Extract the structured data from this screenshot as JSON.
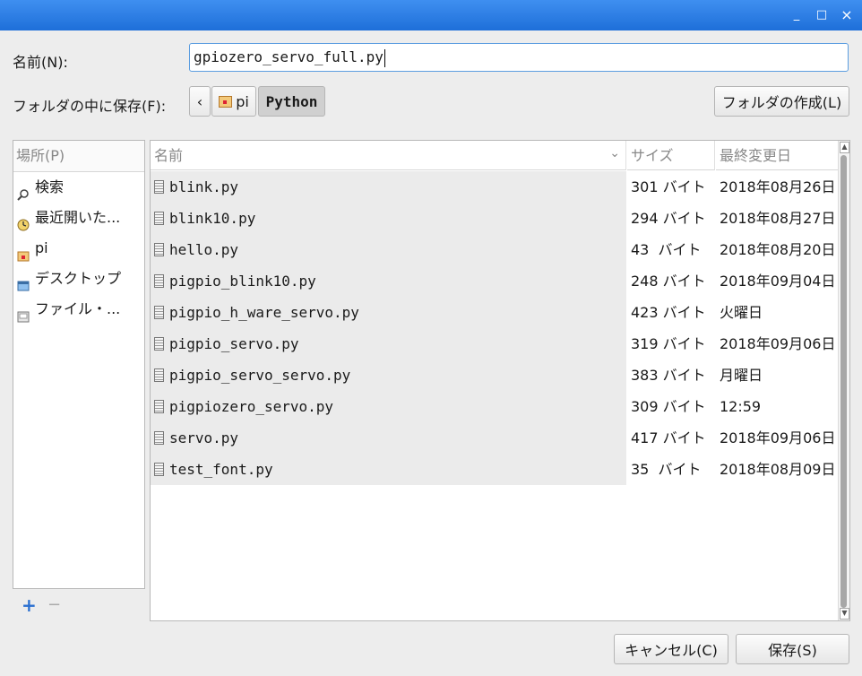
{
  "window": {
    "minimize_glyph": "_",
    "maximize_glyph": "□",
    "close_glyph": "×"
  },
  "name_row": {
    "label": "名前(N):",
    "value": "gpiozero_servo_full.py"
  },
  "folder_row": {
    "label": "フォルダの中に保存(F):",
    "back_glyph": "‹",
    "path": [
      "pi",
      "Python"
    ],
    "create_folder_label": "フォルダの作成(L)"
  },
  "places": {
    "header": "場所(P)",
    "items": [
      {
        "label": "検索",
        "icon": "search-icon"
      },
      {
        "label": "最近開いた...",
        "icon": "clock-icon"
      },
      {
        "label": "pi",
        "icon": "home-folder-icon"
      },
      {
        "label": "デスクトップ",
        "icon": "desktop-icon"
      },
      {
        "label": "ファイル・...",
        "icon": "drive-icon"
      }
    ],
    "add_glyph": "+",
    "remove_glyph": "−"
  },
  "files": {
    "columns": {
      "name": "名前",
      "size": "サイズ",
      "modified": "最終変更日"
    },
    "sort_glyph": "⌄",
    "rows": [
      {
        "name": "blink.py",
        "size": "301 バイト",
        "modified": "2018年08月26日"
      },
      {
        "name": "blink10.py",
        "size": "294 バイト",
        "modified": "2018年08月27日"
      },
      {
        "name": "hello.py",
        "size": "43  バイト",
        "modified": "2018年08月20日"
      },
      {
        "name": "pigpio_blink10.py",
        "size": "248 バイト",
        "modified": "2018年09月04日"
      },
      {
        "name": "pigpio_h_ware_servo.py",
        "size": "423 バイト",
        "modified": "火曜日"
      },
      {
        "name": "pigpio_servo.py",
        "size": "319 バイト",
        "modified": "2018年09月06日"
      },
      {
        "name": "pigpio_servo_servo.py",
        "size": "383 バイト",
        "modified": "月曜日"
      },
      {
        "name": "pigpiozero_servo.py",
        "size": "309 バイト",
        "modified": "12:59"
      },
      {
        "name": "servo.py",
        "size": "417 バイト",
        "modified": "2018年09月06日"
      },
      {
        "name": "test_font.py",
        "size": "35  バイト",
        "modified": "2018年08月09日"
      }
    ]
  },
  "buttons": {
    "cancel": "キャンセル(C)",
    "save": "保存(S)"
  }
}
